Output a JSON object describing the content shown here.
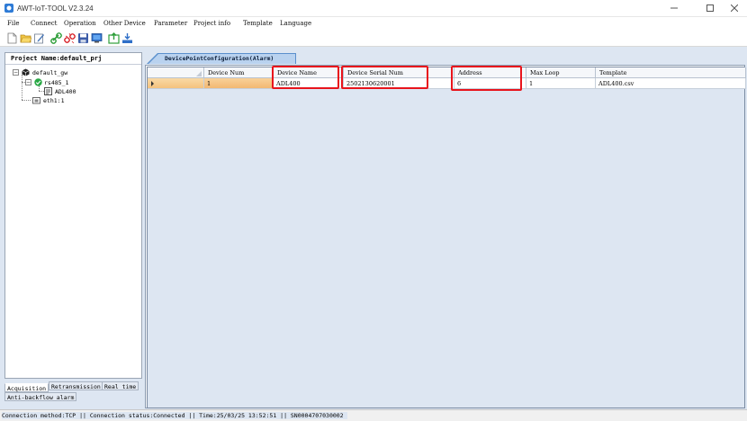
{
  "window": {
    "title": "AWT-IoT-TOOL V2.3.24"
  },
  "menu": [
    "File",
    "Connect",
    "Operation",
    "Other Device",
    "Parameter",
    "Project info",
    "Template",
    "Language"
  ],
  "toolbar_icons": [
    "new-file-icon",
    "open-folder-icon",
    "edit-icon",
    "connect-icon",
    "disconnect-icon",
    "save-icon",
    "monitor-icon",
    "export-icon",
    "download-icon"
  ],
  "project": {
    "header": "Project Name:default_prj",
    "tree": {
      "root": "default_gw",
      "port": "rs485_1",
      "device": "ADL400",
      "eth": "eth1:1"
    }
  },
  "left_tabs": [
    "Acquisition",
    "Retransmission",
    "Real time",
    "Anti-backflow alarm"
  ],
  "active_tab": "DevicePointConfiguration(Alarm)",
  "table": {
    "columns": [
      "Device Num",
      "Device Name",
      "Device Serial Num",
      "Address",
      "Max Loop",
      "Template"
    ],
    "rows": [
      [
        "1",
        "ADL400",
        "2502130620001",
        "6",
        "1",
        "ADL400.csv"
      ]
    ]
  },
  "status": "Connection method:TCP || Connection status:Connected || Time:25/03/25 13:52:51 || SN0004707030002",
  "colors": {
    "highlight": "#e8141c",
    "selection": "#f4c27e",
    "tab_blue": "#4f86c6"
  }
}
